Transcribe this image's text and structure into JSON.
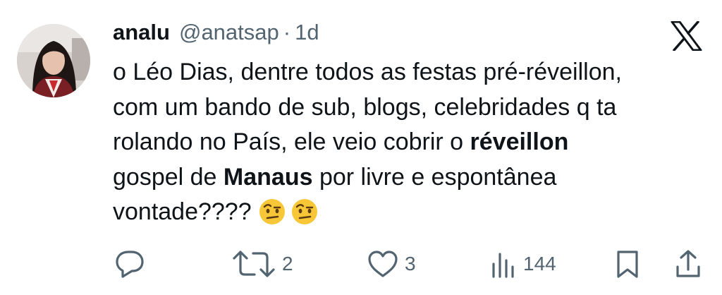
{
  "tweet": {
    "author_name": "analu",
    "author_handle": "@anatsap",
    "separator": "·",
    "time_ago": "1d",
    "text": {
      "p1": "o Léo Dias, dentre todos as festas pré-réveillon,",
      "p2": "com um bando de sub, blogs, celebridades q ta",
      "p3": "rolando no País, ele veio cobrir o ",
      "b1": "réveillon",
      "p4": "gospel de ",
      "b2": "Manaus",
      "p5": " por livre e espontânea",
      "p6": "vontade????"
    },
    "emojis": [
      "face-with-raised-eyebrow",
      "face-with-raised-eyebrow"
    ]
  },
  "actions": {
    "reply": {
      "icon": "reply-icon"
    },
    "retweet": {
      "icon": "retweet-icon",
      "count": "2"
    },
    "like": {
      "icon": "heart-icon",
      "count": "3"
    },
    "views": {
      "icon": "views-icon",
      "count": "144"
    },
    "bookmark": {
      "icon": "bookmark-icon"
    },
    "share": {
      "icon": "share-icon"
    }
  },
  "colors": {
    "text": "#0f1419",
    "secondary": "#536471",
    "background": "#ffffff"
  }
}
